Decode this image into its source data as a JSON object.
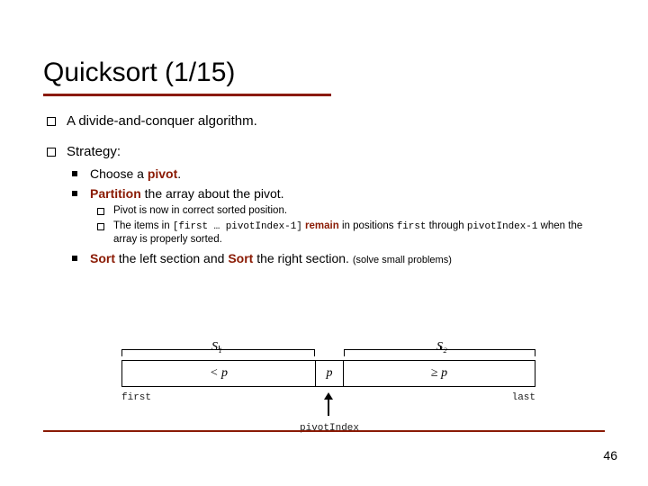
{
  "title": "Quicksort (1/15)",
  "bullets": {
    "l1_a": "A divide-and-conquer algorithm.",
    "l1_b": "Strategy:",
    "l2_a_pre": "Choose a ",
    "l2_a_kw": "pivot",
    "l2_a_post": ".",
    "l2_b_kw": "Partition",
    "l2_b_post": " the array about the pivot.",
    "l3_a": "Pivot is now in correct sorted position.",
    "l3_b_pre": "The items in ",
    "l3_b_code1": "[first … pivotIndex-1]",
    "l3_b_kw": " remain",
    "l3_b_mid": " in positions ",
    "l3_b_code2": "first",
    "l3_b_mid2": " through ",
    "l3_b_code3": "pivotIndex-1",
    "l3_b_post": " when the array is properly sorted.",
    "l2_c_kw1": "Sort",
    "l2_c_mid1": " the left section and ",
    "l2_c_kw2": "Sort",
    "l2_c_mid2": " the right section. ",
    "l2_c_note": "(solve small problems)"
  },
  "diagram": {
    "s1": "S₁",
    "s2": "S₂",
    "left": "< p",
    "mid": "p",
    "right": "≥ p",
    "first": "first",
    "last": "last",
    "pivotIndex": "pivotIndex"
  },
  "page": "46"
}
